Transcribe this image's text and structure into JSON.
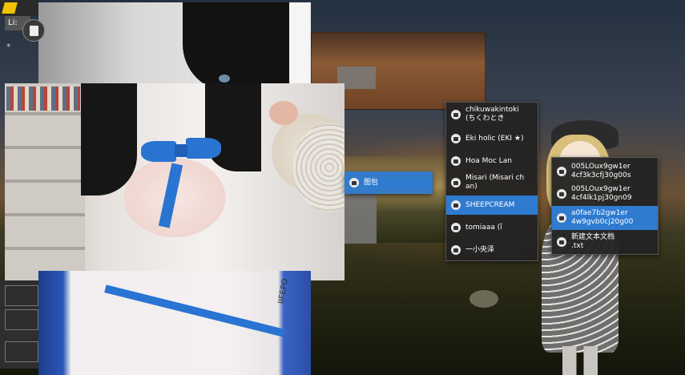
{
  "top_bar": {
    "side_label": "Li:",
    "star": "*"
  },
  "photos": {
    "caption": "IIFEPO"
  },
  "menu_level1": {
    "items": [
      {
        "label": "图包",
        "selected": true
      }
    ]
  },
  "menu_level2": {
    "items": [
      {
        "label": "chikuwakintoki\n(ちくわとき",
        "selected": false
      },
      {
        "label": "Eki holic (EKI ★)",
        "selected": false
      },
      {
        "label": "Hoa Moc Lan",
        "selected": false
      },
      {
        "label": "Misari (Misari ch\nan)",
        "selected": false
      },
      {
        "label": "SHEEPCREAM",
        "selected": true
      },
      {
        "label": "tomiaaa (ĩ",
        "selected": false
      },
      {
        "label": "一小央泽",
        "selected": false
      }
    ]
  },
  "menu_level3": {
    "items": [
      {
        "label": "005LOux9gw1er\n4cf3k3cfj30g00s",
        "selected": false
      },
      {
        "label": "005LOux9gw1er\n4cf4lk1pj30gn09",
        "selected": false
      },
      {
        "label": "a0fae7b2gw1er\n4w9gvb0cj20g00",
        "selected": true
      },
      {
        "label": "新建文本文档\n.txt",
        "selected": false
      }
    ]
  },
  "colors": {
    "menu_bg": "#232323",
    "selection": "#2e7bd0",
    "bow_blue": "#2a74d1"
  }
}
